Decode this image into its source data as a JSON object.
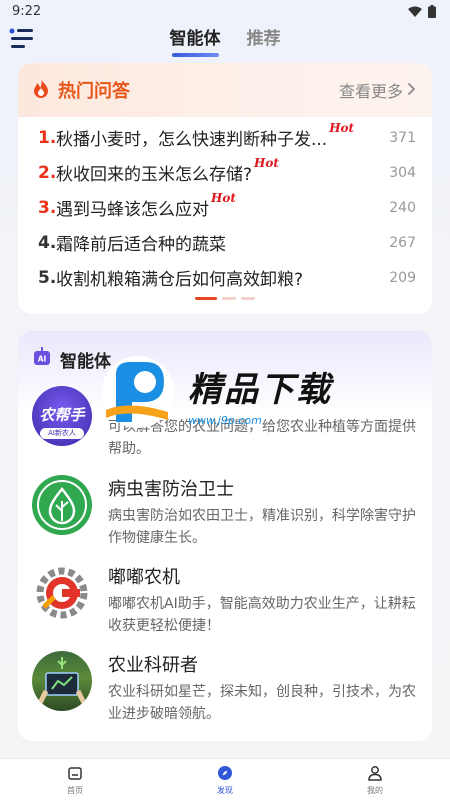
{
  "status_bar": {
    "time": "9:22"
  },
  "header": {
    "tabs": [
      {
        "label": "智能体",
        "active": true
      },
      {
        "label": "推荐",
        "active": false
      }
    ]
  },
  "hot_qa": {
    "title": "热门问答",
    "more_label": "查看更多",
    "hot_tag": "Hot",
    "items": [
      {
        "rank": "1.",
        "text": "秋播小麦时，怎么快速判断种子发...",
        "count": "371",
        "hot": true
      },
      {
        "rank": "2.",
        "text": "秋收回来的玉米怎么存储?",
        "count": "304",
        "hot": true
      },
      {
        "rank": "3.",
        "text": "遇到马蜂该怎么应对",
        "count": "240",
        "hot": true
      },
      {
        "rank": "4.",
        "text": "霜降前后适合种的蔬菜",
        "count": "267",
        "hot": false
      },
      {
        "rank": "5.",
        "text": "收割机粮箱满仓后如何高效卸粮?",
        "count": "209",
        "hot": false
      }
    ],
    "pager": {
      "pages": 3,
      "current": 1
    }
  },
  "agents": {
    "title": "智能体",
    "items": [
      {
        "name": "农帮手",
        "avatar_text": "农帮手",
        "avatar_sub": "AI新农人",
        "description": "可以解答您的农业问题，给您农业种植等方面提供帮助。"
      },
      {
        "name": "病虫害防治卫士",
        "description": "病虫害防治如农田卫士，精准识别，科学除害守护作物健康生长。"
      },
      {
        "name": "嘟嘟农机",
        "description": "嘟嘟农机AI助手，智能高效助力农业生产，让耕耘收获更轻松便捷！"
      },
      {
        "name": "农业科研者",
        "description": "农业科研如星芒，探未知，创良种，引技术，为农业进步破暗领航。"
      }
    ]
  },
  "watermark": {
    "text": "精品下载",
    "url": "www.j9p.com"
  },
  "bottom_nav": [
    {
      "label": "首页",
      "icon": "home-icon",
      "active": false
    },
    {
      "label": "发现",
      "icon": "compass-icon",
      "active": true
    },
    {
      "label": "我的",
      "icon": "user-icon",
      "active": false
    }
  ],
  "colors": {
    "accent": "#3057d8",
    "hot": "#e8571a",
    "rank_red": "#e8331a"
  }
}
